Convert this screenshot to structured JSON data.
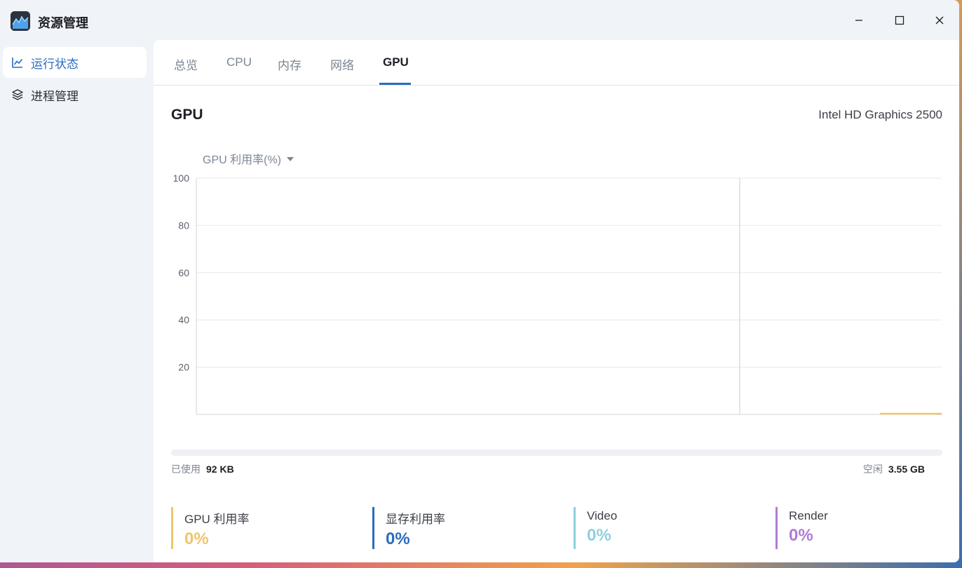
{
  "app": {
    "title": "资源管理"
  },
  "sidebar": {
    "items": [
      {
        "label": "运行状态",
        "active": true,
        "icon": "line-chart-icon"
      },
      {
        "label": "进程管理",
        "active": false,
        "icon": "layers-icon"
      }
    ]
  },
  "tabs": [
    {
      "label": "总览"
    },
    {
      "label": "CPU"
    },
    {
      "label": "内存"
    },
    {
      "label": "网络"
    },
    {
      "label": "GPU",
      "active": true
    }
  ],
  "section": {
    "title": "GPU",
    "device_name": "Intel HD Graphics 2500"
  },
  "metric_select": {
    "value": "GPU 利用率(%)"
  },
  "chart_data": {
    "type": "line",
    "ylim": [
      0,
      100
    ],
    "yticks": [
      "100",
      "80",
      "60",
      "40",
      "20"
    ],
    "series": [
      {
        "color": "#f2c46d",
        "x": [
          0.917,
          1.0
        ],
        "values": [
          0,
          0
        ]
      }
    ],
    "xlim": [
      0,
      1
    ],
    "grid": true
  },
  "memory": {
    "used_label": "已使用",
    "used_value": "92 KB",
    "free_label": "空闲",
    "free_value": "3.55 GB",
    "used_fraction": 0.0
  },
  "stats": [
    {
      "label": "GPU 利用率",
      "value": "0%",
      "color": "#f2c46d"
    },
    {
      "label": "显存利用率",
      "value": "0%",
      "color": "#2a6cbf"
    },
    {
      "label": "Video",
      "value": "0%",
      "color": "#8fd0e0"
    },
    {
      "label": "Render",
      "value": "0%",
      "color": "#b07ad6"
    }
  ]
}
